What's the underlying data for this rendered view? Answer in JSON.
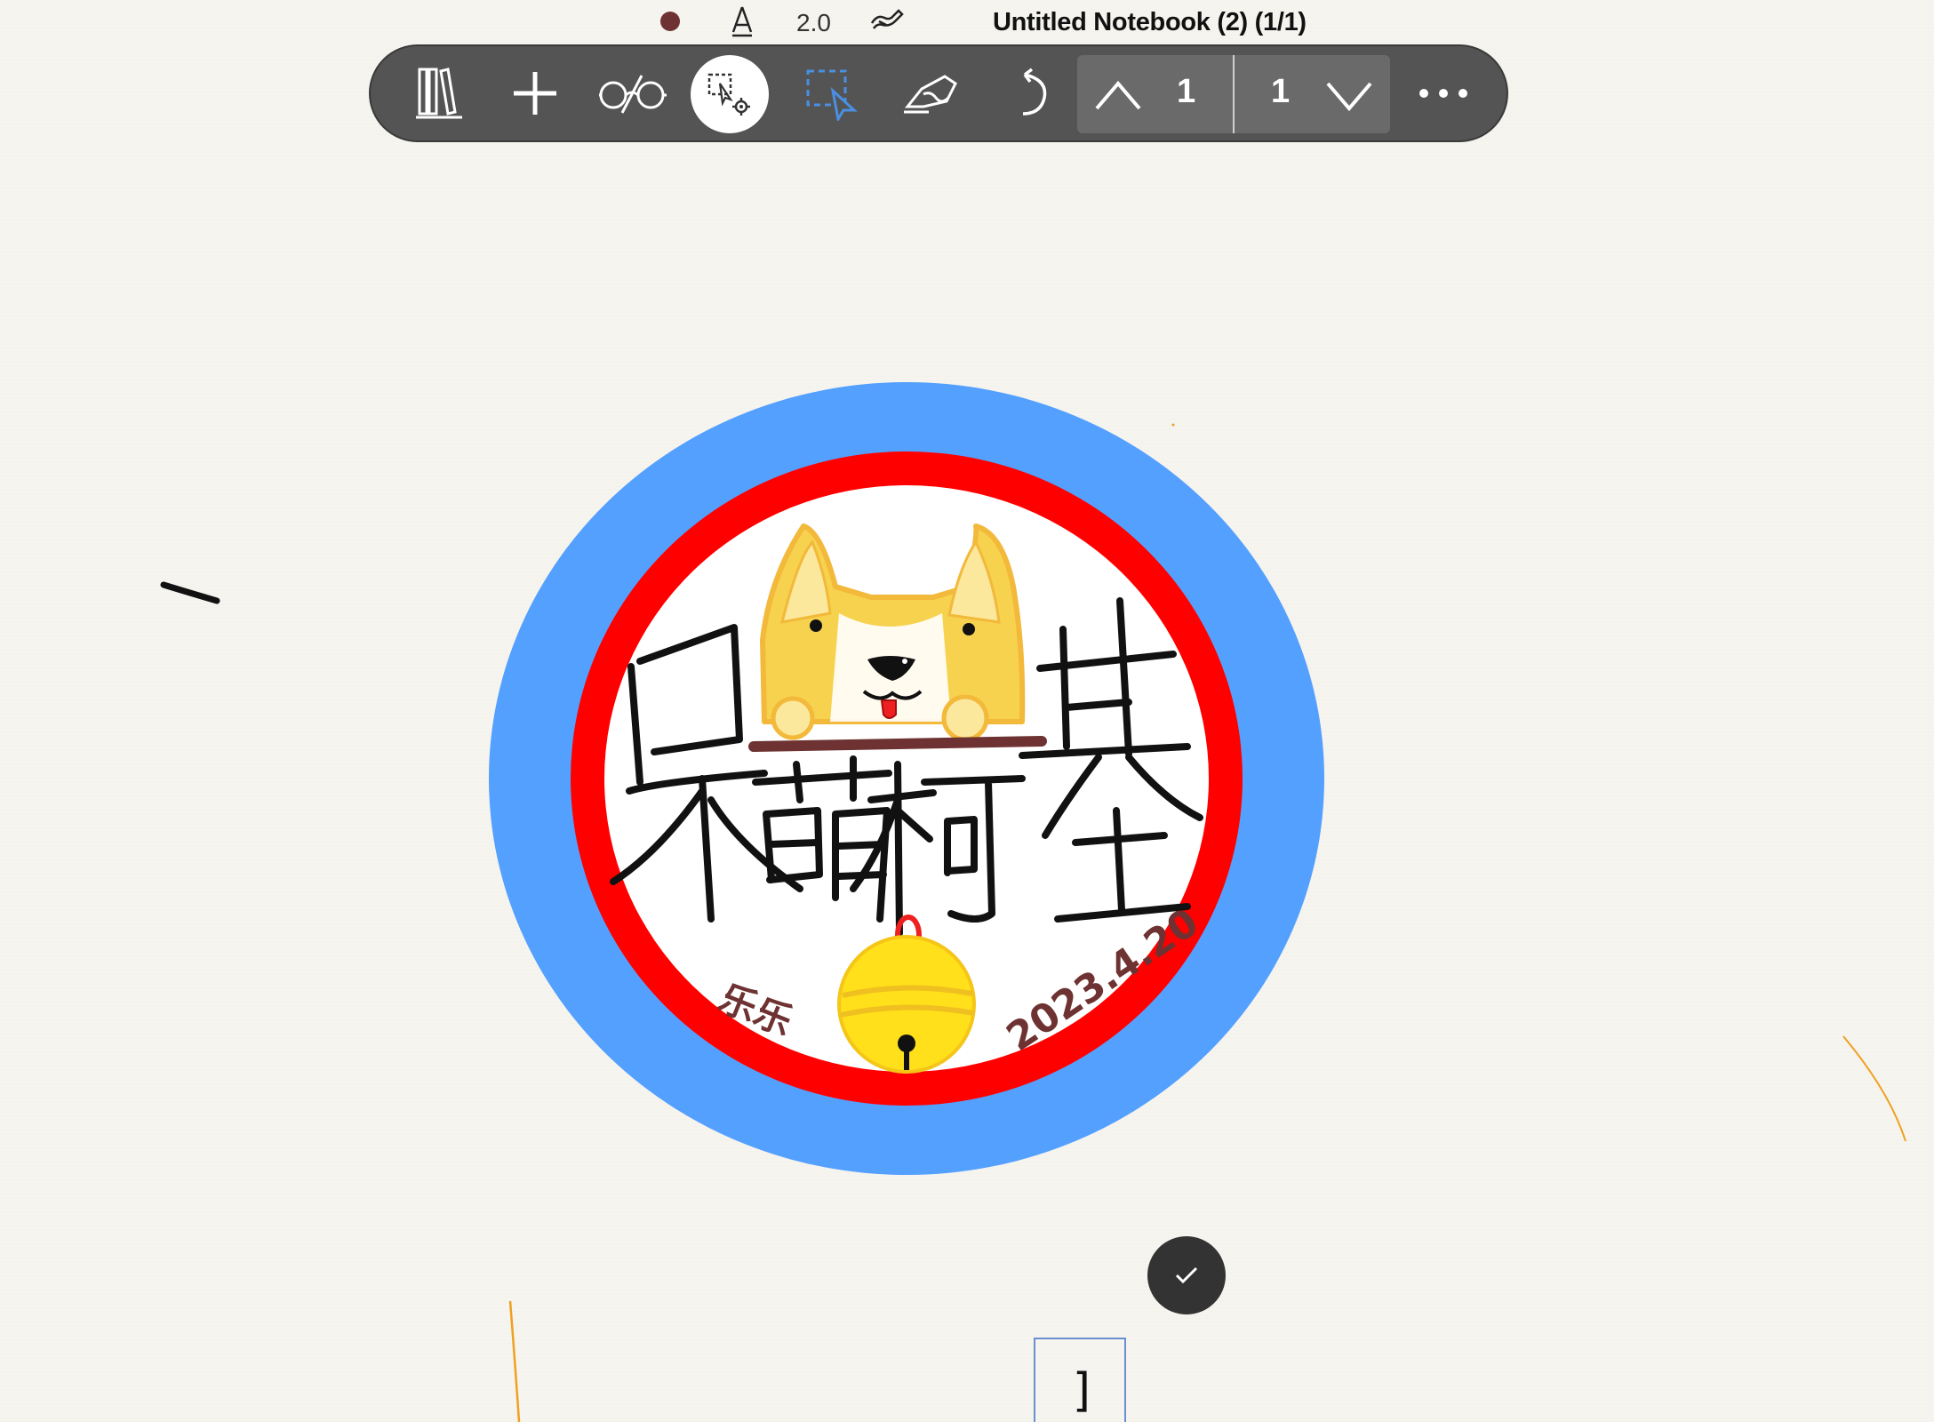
{
  "status": {
    "pen_color": "#6e3232",
    "pen_size": "2.0",
    "notebook_title": "Untitled Notebook (2) (1/1)"
  },
  "toolbar": {
    "icons": [
      "library-icon",
      "add-icon",
      "read-mode-icon",
      "lasso-settings-icon",
      "lasso-select-icon",
      "handwriting-recognition-icon",
      "undo-icon",
      "more-icon"
    ],
    "current_page": "1",
    "total_pages": "1"
  },
  "canvas": {
    "badge_chars": [
      "呆",
      "萌",
      "柯",
      "基"
    ],
    "signature": "乐乐",
    "date": "2023.4.20",
    "text_box_content": "]",
    "colors": {
      "outer_ring": "#54a0fe",
      "inner_ring": "#ff0000",
      "dog": "#f7d24f",
      "bell": "#ffe01a",
      "ink": "#111111",
      "signature": "#6e3232",
      "stray_line": "#f0a020"
    }
  }
}
